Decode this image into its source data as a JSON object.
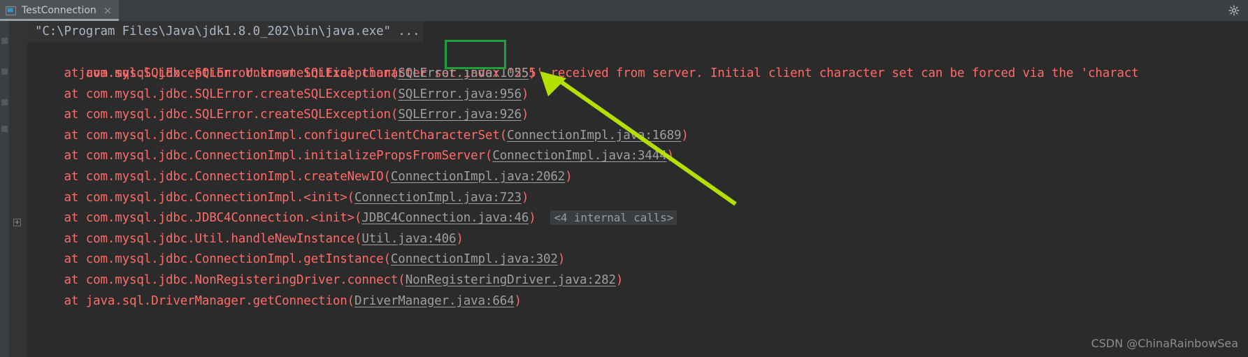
{
  "window": {
    "tab": {
      "label": "TestConnection",
      "icon": "run-configuration-icon",
      "close_label": "×"
    },
    "settings_icon": "gear-icon"
  },
  "gutter": {
    "fold_marker_label": "+"
  },
  "console": {
    "command_line": "\"C:\\Program Files\\Java\\jdk1.8.0_202\\bin\\java.exe\" ...",
    "exception_line": {
      "before_highlight": "java.sql.SQLException: Unknown initial character set index ",
      "highlight": "'255'",
      "after_highlight": " received from server. Initial client character set can be forced via the 'charact"
    },
    "stack_frames": [
      {
        "indent": "    ",
        "text": "at com.mysql.jdbc.SQLError.createSQLException(",
        "link": "SQLError.java:1055",
        "tail": ")",
        "badge": ""
      },
      {
        "indent": "    ",
        "text": "at com.mysql.jdbc.SQLError.createSQLException(",
        "link": "SQLError.java:956",
        "tail": ")",
        "badge": ""
      },
      {
        "indent": "    ",
        "text": "at com.mysql.jdbc.SQLError.createSQLException(",
        "link": "SQLError.java:926",
        "tail": ")",
        "badge": ""
      },
      {
        "indent": "    ",
        "text": "at com.mysql.jdbc.ConnectionImpl.configureClientCharacterSet(",
        "link": "ConnectionImpl.java:1689",
        "tail": ")",
        "badge": ""
      },
      {
        "indent": "    ",
        "text": "at com.mysql.jdbc.ConnectionImpl.initializePropsFromServer(",
        "link": "ConnectionImpl.java:3444",
        "tail": ")",
        "badge": ""
      },
      {
        "indent": "    ",
        "text": "at com.mysql.jdbc.ConnectionImpl.createNewIO(",
        "link": "ConnectionImpl.java:2062",
        "tail": ")",
        "badge": ""
      },
      {
        "indent": "    ",
        "text": "at com.mysql.jdbc.ConnectionImpl.<init>(",
        "link": "ConnectionImpl.java:723",
        "tail": ")",
        "badge": ""
      },
      {
        "indent": "    ",
        "text": "at com.mysql.jdbc.JDBC4Connection.<init>(",
        "link": "JDBC4Connection.java:46",
        "tail": ")",
        "badge": "<4 internal calls>"
      },
      {
        "indent": "    ",
        "text": "at com.mysql.jdbc.Util.handleNewInstance(",
        "link": "Util.java:406",
        "tail": ")",
        "badge": ""
      },
      {
        "indent": "    ",
        "text": "at com.mysql.jdbc.ConnectionImpl.getInstance(",
        "link": "ConnectionImpl.java:302",
        "tail": ")",
        "badge": ""
      },
      {
        "indent": "    ",
        "text": "at com.mysql.jdbc.NonRegisteringDriver.connect(",
        "link": "NonRegisteringDriver.java:282",
        "tail": ")",
        "badge": ""
      },
      {
        "indent": "    ",
        "text": "at java.sql.DriverManager.getConnection(",
        "link": "DriverManager.java:664",
        "tail": ")",
        "badge": ""
      }
    ]
  },
  "annotations": {
    "highlight_rect_color": "#1f9f3a",
    "arrow_color": "#b3e000",
    "arrow_name": "green-arrow-annotation"
  },
  "watermark": {
    "text": "CSDN @ChinaRainbowSea"
  },
  "colors": {
    "background": "#2b2b2b",
    "tabbar": "#3c3f41",
    "error_text": "#ff6b68",
    "link_text": "#9f9f9f",
    "command_text": "#a9b7c6"
  }
}
